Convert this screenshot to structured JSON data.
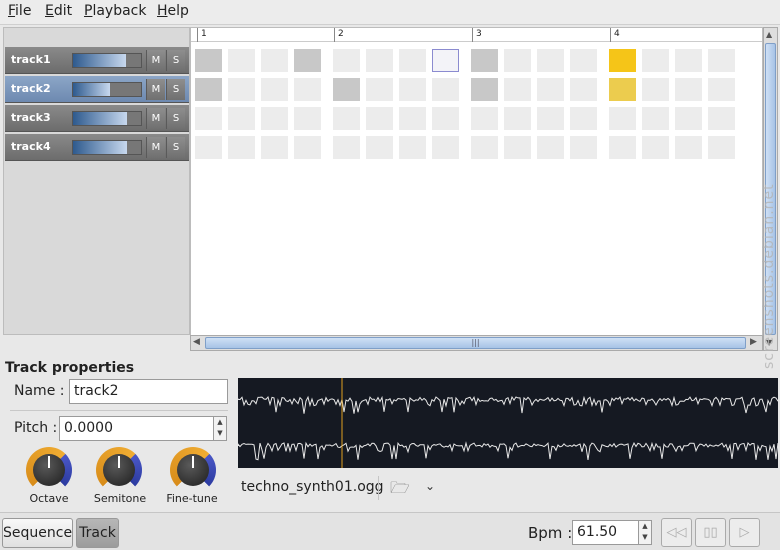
{
  "menu": {
    "file": "File",
    "edit": "Edit",
    "playback": "Playback",
    "help": "Help"
  },
  "tracks": [
    {
      "name": "track1",
      "volume": 0.78,
      "selected": false
    },
    {
      "name": "track2",
      "volume": 0.55,
      "selected": true
    },
    {
      "name": "track3",
      "volume": 0.8,
      "selected": false
    },
    {
      "name": "track4",
      "volume": 0.8,
      "selected": false
    }
  ],
  "track_buttons": {
    "mute": "M",
    "solo": "S"
  },
  "sequencer": {
    "bars": [
      "1",
      "2",
      "3",
      "4"
    ],
    "steps_per_row": 16,
    "pattern": [
      [
        1,
        0,
        0,
        1,
        0,
        0,
        0,
        "h",
        1,
        0,
        0,
        0,
        "a",
        0,
        0,
        0
      ],
      [
        1,
        0,
        0,
        0,
        1,
        0,
        0,
        0,
        1,
        0,
        0,
        0,
        "b",
        0,
        0,
        0
      ],
      [
        0,
        0,
        0,
        0,
        0,
        0,
        0,
        0,
        0,
        0,
        0,
        0,
        0,
        0,
        0,
        0
      ],
      [
        0,
        0,
        0,
        0,
        0,
        0,
        0,
        0,
        0,
        0,
        0,
        0,
        0,
        0,
        0,
        0
      ]
    ],
    "accent_color": "#f5c518"
  },
  "scrollbar_label": "|||",
  "watermark": "screenshots.debian.net",
  "properties": {
    "header": "Track properties",
    "name_label": "Name :",
    "name_value": "track2",
    "pitch_label": "Pitch :",
    "pitch_value": "0.0000",
    "knobs": [
      {
        "label": "Octave",
        "level": 0.5
      },
      {
        "label": "Semitone",
        "level": 0.5
      },
      {
        "label": "Fine-tune",
        "level": 0.5
      }
    ]
  },
  "sample": {
    "filename": "techno_synth01.ogg",
    "open_icon": "folder-open-icon",
    "dropdown_icon": "chevron-down-icon"
  },
  "bottom": {
    "sequence_tab": "Sequence",
    "track_tab": "Track",
    "bpm_label": "Bpm :",
    "bpm_value": "61.50",
    "rewind_icon": "rewind-icon",
    "pause_icon": "pause-icon",
    "play_icon": "play-icon"
  }
}
